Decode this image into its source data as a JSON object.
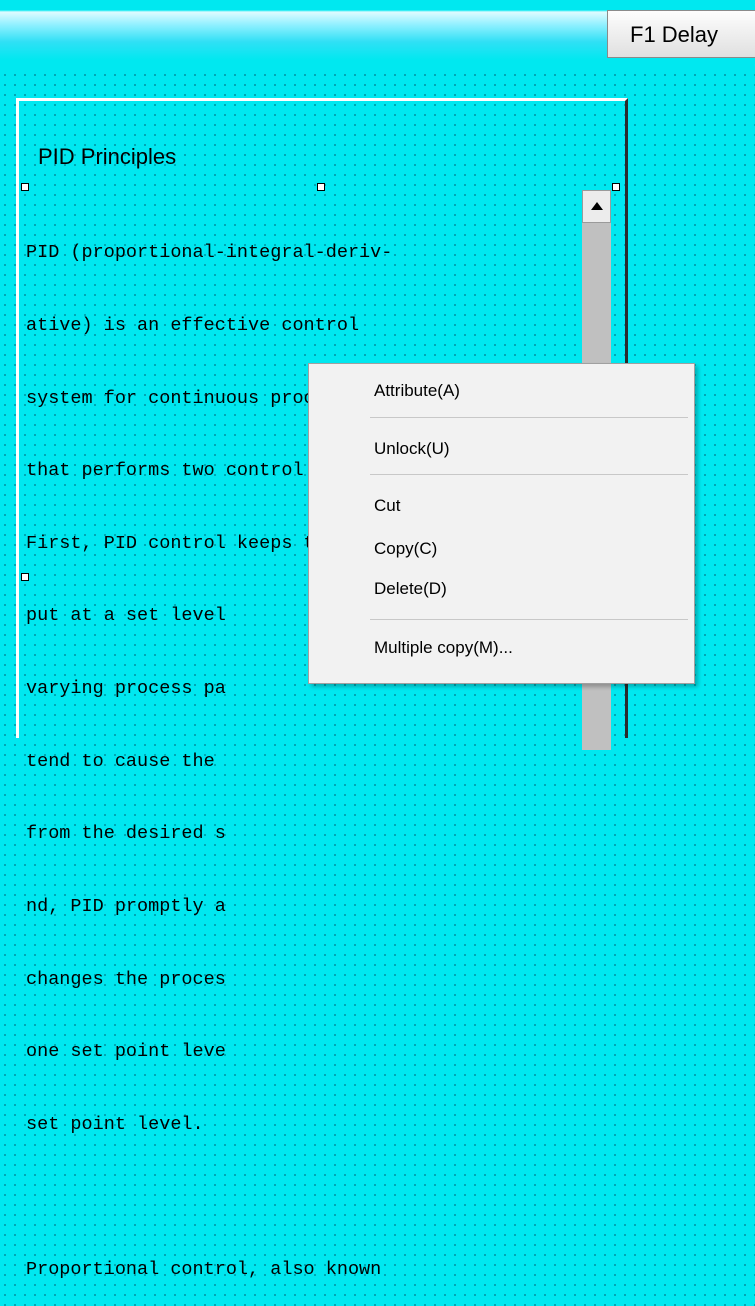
{
  "header": {
    "button_label": "F1 Delay"
  },
  "panel": {
    "title": "PID Principles",
    "text_lines": [
      "PID (proportional-integral-deriv-",
      "ative) is an effective control",
      "system for continuous processes",
      "that performs two control tasks.",
      "First, PID control keeps the out-",
      "put at a set level",
      "varying process pa",
      "tend to cause the",
      "from the desired s",
      "nd, PID promptly a",
      "changes the proces",
      "one set point leve",
      "set point level.",
      "",
      "Proportional control, also known"
    ]
  },
  "context_menu": {
    "items": [
      "Attribute(A)",
      "Unlock(U)",
      "Cut",
      "Copy(C)",
      "Delete(D)",
      "Multiple copy(M)..."
    ]
  }
}
